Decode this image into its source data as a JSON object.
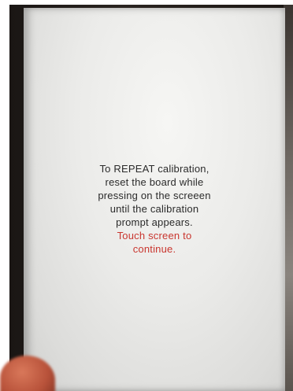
{
  "screen": {
    "message_lines": [
      "To REPEAT calibration,",
      "reset the board while",
      "pressing on the screeen",
      "until the calibration",
      "prompt appears."
    ],
    "prompt_lines": [
      "Touch screen to",
      "continue."
    ]
  },
  "colors": {
    "message_text": "#2b2b2b",
    "prompt_text": "#c9362f",
    "screen_bg": "#ebebe9",
    "device_bezel": "#1c1714"
  }
}
